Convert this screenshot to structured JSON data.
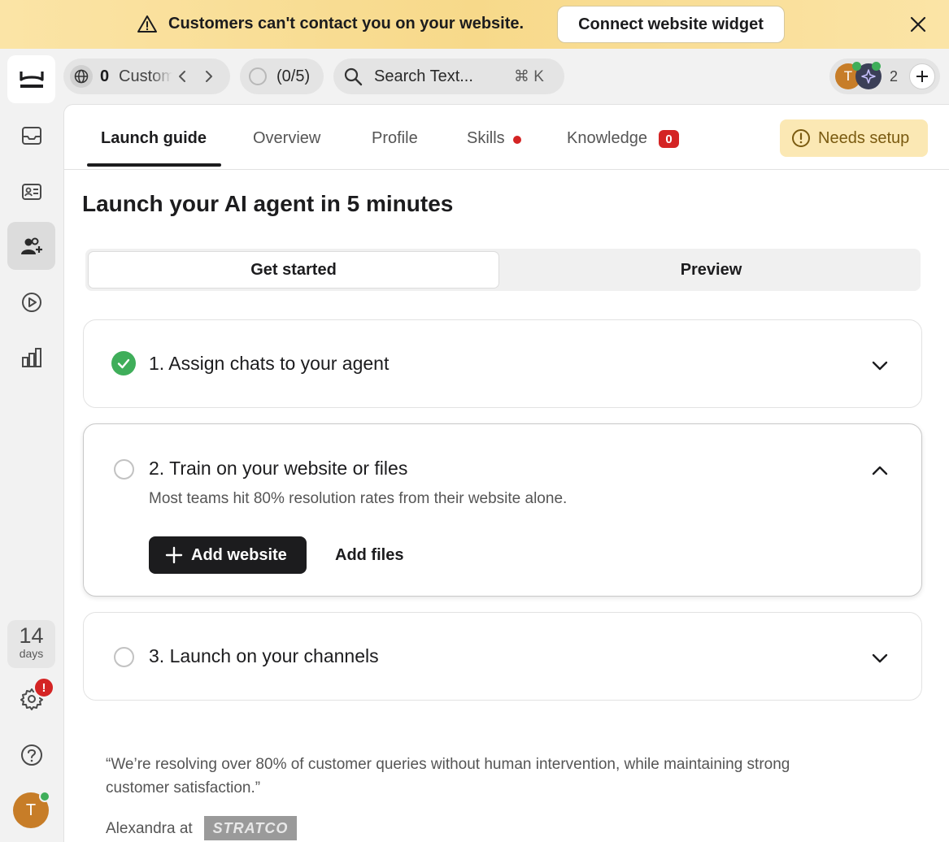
{
  "banner": {
    "message": "Customers can't contact you on your website.",
    "cta_label": "Connect website widget"
  },
  "sidebar": {
    "trial_number": "14",
    "trial_unit": "days",
    "settings_badge": "!",
    "user_initial": "T"
  },
  "topbar": {
    "customer_count": "0",
    "customer_label": "Customers",
    "progress_label": "(0/5)",
    "search_placeholder": "Search Text...",
    "search_shortcut": "⌘ K",
    "team_initial": "T",
    "team_count": "2"
  },
  "tabs": [
    {
      "label": "Launch guide",
      "active": true
    },
    {
      "label": "Overview"
    },
    {
      "label": "Profile"
    },
    {
      "label": "Skills"
    },
    {
      "label": "Knowledge",
      "badge": "0"
    }
  ],
  "status_label": "Needs setup",
  "page_title": "Launch your AI agent in 5 minutes",
  "segments": [
    "Get started",
    "Preview"
  ],
  "steps": [
    {
      "title": "1. Assign chats to your agent",
      "done": true
    },
    {
      "title": "2. Train on your website or files",
      "description": "Most teams hit 80% resolution rates from their website alone.",
      "primary_action": "Add website",
      "secondary_action": "Add files"
    },
    {
      "title": "3. Launch on your channels"
    }
  ],
  "testimonial": {
    "quote": "“We’re resolving over 80% of customer queries without human intervention, while maintaining strong customer satisfaction.”",
    "attribution": "Alexandra at",
    "company_logo_text": "STRATCO"
  },
  "colors": {
    "banner": "#f7d98a",
    "primary": "#1c1c1e",
    "success": "#3fae5a",
    "danger": "#d42424",
    "warning_bg": "#fbe8b4"
  }
}
